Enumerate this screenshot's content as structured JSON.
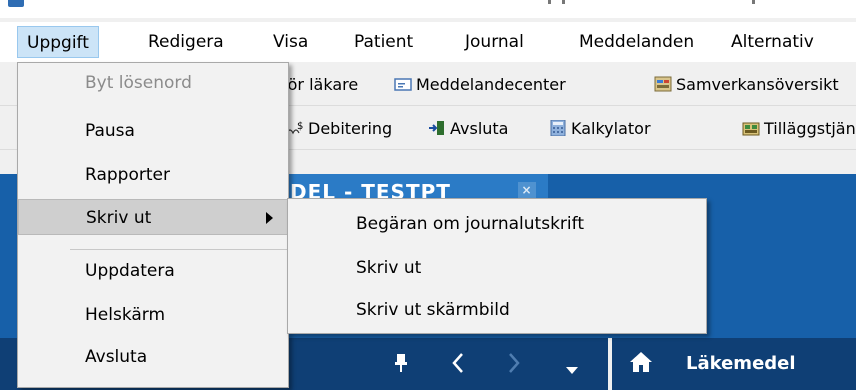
{
  "menubar": {
    "items": [
      {
        "label": "Uppgift"
      },
      {
        "label": "Redigera"
      },
      {
        "label": "Visa"
      },
      {
        "label": "Patient"
      },
      {
        "label": "Journal"
      },
      {
        "label": "Meddelanden"
      },
      {
        "label": "Alternativ"
      }
    ]
  },
  "toolbar1": {
    "items": [
      {
        "label": "för läkare",
        "icon": "doctor-icon"
      },
      {
        "label": "Meddelandecenter",
        "icon": "message-center-icon"
      },
      {
        "label": "Samverkansöversikt",
        "icon": "collaboration-icon"
      }
    ]
  },
  "toolbar2": {
    "items": [
      {
        "label": "Debitering",
        "icon": "billing-icon"
      },
      {
        "label": "Avsluta",
        "icon": "exit-icon"
      },
      {
        "label": "Kalkylator",
        "icon": "calculator-icon"
      },
      {
        "label": "Tilläggstjänster",
        "icon": "addons-icon"
      }
    ]
  },
  "tab": {
    "label": "DEL - TESTPT",
    "close": "×"
  },
  "bottombar": {
    "home_label": "Läkemedel"
  },
  "dropdown": {
    "items": [
      {
        "label": "Byt lösenord",
        "disabled": true
      },
      {
        "label": "Pausa"
      },
      {
        "label": "Rapporter"
      },
      {
        "label": "Skriv ut",
        "submenu": true,
        "highlighted": true
      },
      {
        "label": "Uppdatera"
      },
      {
        "label": "Helskärm"
      },
      {
        "label": "Avsluta"
      }
    ]
  },
  "submenu": {
    "items": [
      {
        "label": "Begäran om journalutskrift"
      },
      {
        "label": "Skriv ut"
      },
      {
        "label": "Skriv ut skärmbild"
      }
    ]
  },
  "colors": {
    "accent_blue": "#1760a9",
    "dark_blue": "#0f3f75",
    "menu_highlight": "#cce4f7"
  }
}
